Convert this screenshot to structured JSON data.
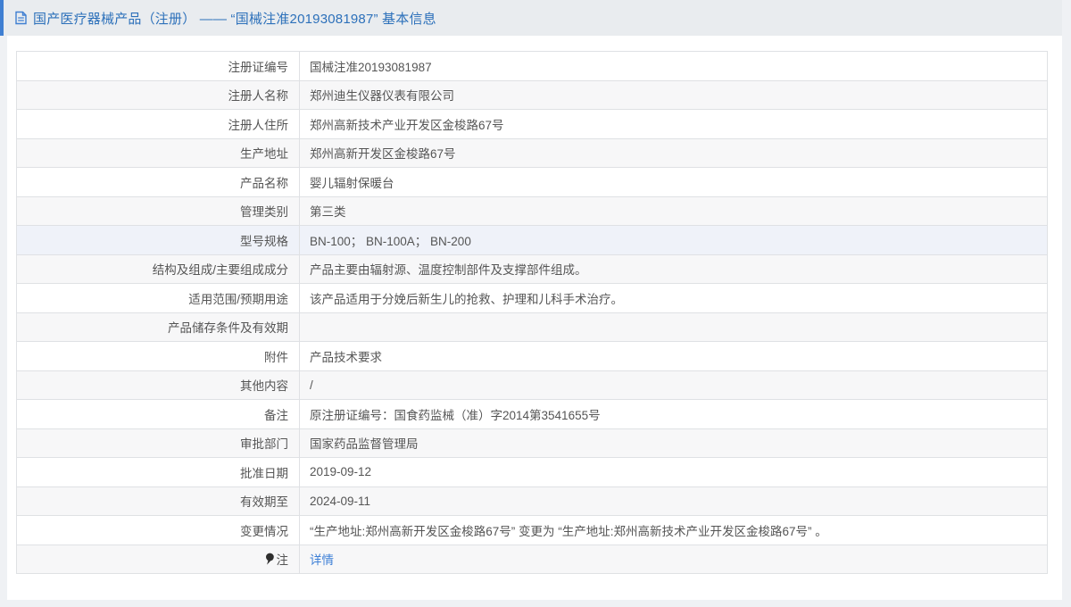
{
  "header": {
    "title": "国产医疗器械产品（注册） —— “国械注准20193081987” 基本信息"
  },
  "colors": {
    "accent": "#3f7fd2",
    "title_blue": "#2c70ba",
    "link_blue": "#3d7fd6",
    "row_alt": "#f7f7f8",
    "row_highlight": "#eff2f9"
  },
  "table": {
    "rows": [
      {
        "label": "注册证编号",
        "value": "国械注准20193081987"
      },
      {
        "label": "注册人名称",
        "value": "郑州迪生仪器仪表有限公司"
      },
      {
        "label": "注册人住所",
        "value": "郑州高新技术产业开发区金梭路67号"
      },
      {
        "label": "生产地址",
        "value": "郑州高新开发区金梭路67号"
      },
      {
        "label": "产品名称",
        "value": "婴儿辐射保暖台"
      },
      {
        "label": "管理类别",
        "value": "第三类"
      },
      {
        "label": "型号规格",
        "value": "BN-100； BN-100A； BN-200",
        "highlight": true
      },
      {
        "label": "结构及组成/主要组成成分",
        "value": "产品主要由辐射源、温度控制部件及支撑部件组成。"
      },
      {
        "label": "适用范围/预期用途",
        "value": "该产品适用于分娩后新生儿的抢救、护理和儿科手术治疗。"
      },
      {
        "label": "产品储存条件及有效期",
        "value": ""
      },
      {
        "label": "附件",
        "value": "产品技术要求"
      },
      {
        "label": "其他内容",
        "value": "/"
      },
      {
        "label": "备注",
        "value": "原注册证编号：国食药监械（准）字2014第3541655号"
      },
      {
        "label": "审批部门",
        "value": "国家药品监督管理局"
      },
      {
        "label": "批准日期",
        "value": "2019-09-12"
      },
      {
        "label": "有效期至",
        "value": "2024-09-11"
      },
      {
        "label": "变更情况",
        "value": "“生产地址:郑州高新开发区金梭路67号” 变更为 “生产地址:郑州高新技术产业开发区金梭路67号” 。"
      },
      {
        "label": "注",
        "icon": "pin",
        "value": "详情",
        "link": true
      }
    ]
  }
}
